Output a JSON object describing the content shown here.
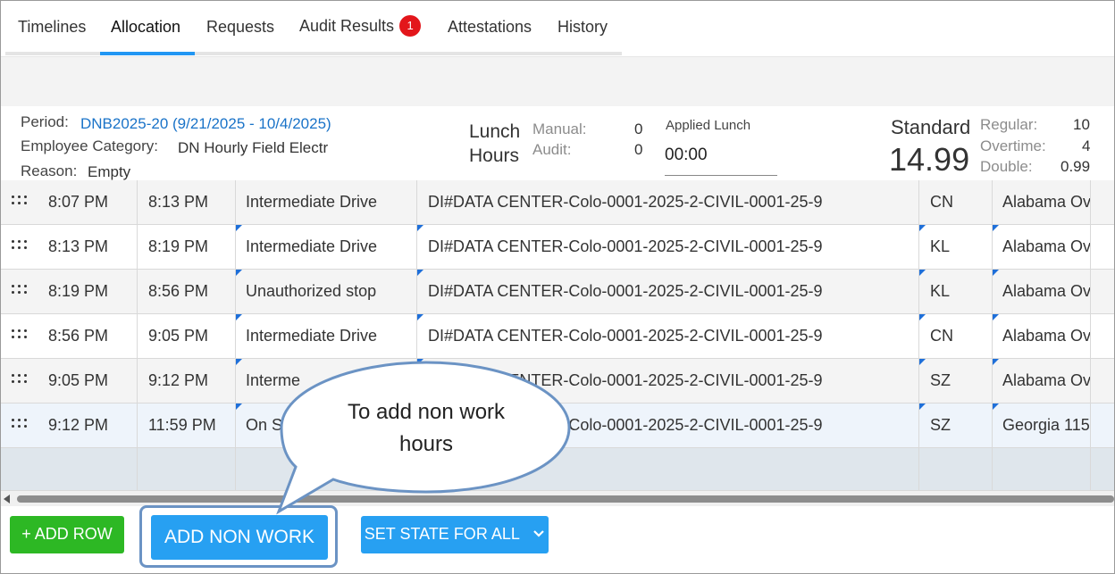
{
  "tabs": [
    {
      "label": "Timelines"
    },
    {
      "label": "Allocation",
      "active": true
    },
    {
      "label": "Requests"
    },
    {
      "label": "Audit Results",
      "badge": "1"
    },
    {
      "label": "Attestations"
    },
    {
      "label": "History"
    }
  ],
  "info": {
    "period_label": "Period:",
    "period_value": "DNB2025-20 (9/21/2025 - 10/4/2025)",
    "category_label": "Employee Category:",
    "category_value": "DN Hourly Field Electr",
    "reason_label": "Reason:",
    "reason_value": "Empty"
  },
  "lunch": {
    "title_line1": "Lunch",
    "title_line2": "Hours",
    "manual_label": "Manual:",
    "manual_value": "0",
    "audit_label": "Audit:",
    "audit_value": "0",
    "applied_label": "Applied Lunch",
    "applied_value": "00:00"
  },
  "standard": {
    "label": "Standard",
    "value": "14.99",
    "regular_label": "Regular:",
    "regular_value": "10",
    "overtime_label": "Overtime:",
    "overtime_value": "4",
    "double_label": "Double:",
    "double_value": "0.99"
  },
  "rows": [
    {
      "start": "8:07 PM",
      "end": "8:13 PM",
      "activity": "Intermediate Drive",
      "job": "DI#DATA CENTER-Colo-0001-2025-2-CIVIL-0001-25-9",
      "code": "CN",
      "location": "Alabama Ov"
    },
    {
      "start": "8:13 PM",
      "end": "8:19 PM",
      "activity": "Intermediate Drive",
      "job": "DI#DATA CENTER-Colo-0001-2025-2-CIVIL-0001-25-9",
      "code": "KL",
      "location": "Alabama Ov"
    },
    {
      "start": "8:19 PM",
      "end": "8:56 PM",
      "activity": "Unauthorized stop",
      "job": "DI#DATA CENTER-Colo-0001-2025-2-CIVIL-0001-25-9",
      "code": "KL",
      "location": "Alabama Ov"
    },
    {
      "start": "8:56 PM",
      "end": "9:05 PM",
      "activity": "Intermediate Drive",
      "job": "DI#DATA CENTER-Colo-0001-2025-2-CIVIL-0001-25-9",
      "code": "CN",
      "location": "Alabama Ov"
    },
    {
      "start": "9:05 PM",
      "end": "9:12 PM",
      "activity": "Interme",
      "job": "DI#DATA CENTER-Colo-0001-2025-2-CIVIL-0001-25-9",
      "code": "SZ",
      "location": "Alabama Ov"
    },
    {
      "start": "9:12 PM",
      "end": "11:59 PM",
      "activity": "On S",
      "job": "DI#DATA CENTER-Colo-0001-2025-2-CIVIL-0001-25-9",
      "code": "SZ",
      "location": "Georgia 115"
    }
  ],
  "buttons": {
    "add_row": "+ ADD ROW",
    "add_non_work": "ADD NON WORK",
    "set_state": "SET STATE FOR ALL"
  },
  "callout": {
    "line1": "To add non work",
    "line2": "hours"
  },
  "colors": {
    "accent": "#2196f3",
    "link": "#1a73c8",
    "badge": "#e3161b",
    "green": "#2db824",
    "callout_border": "#6b93c4"
  }
}
